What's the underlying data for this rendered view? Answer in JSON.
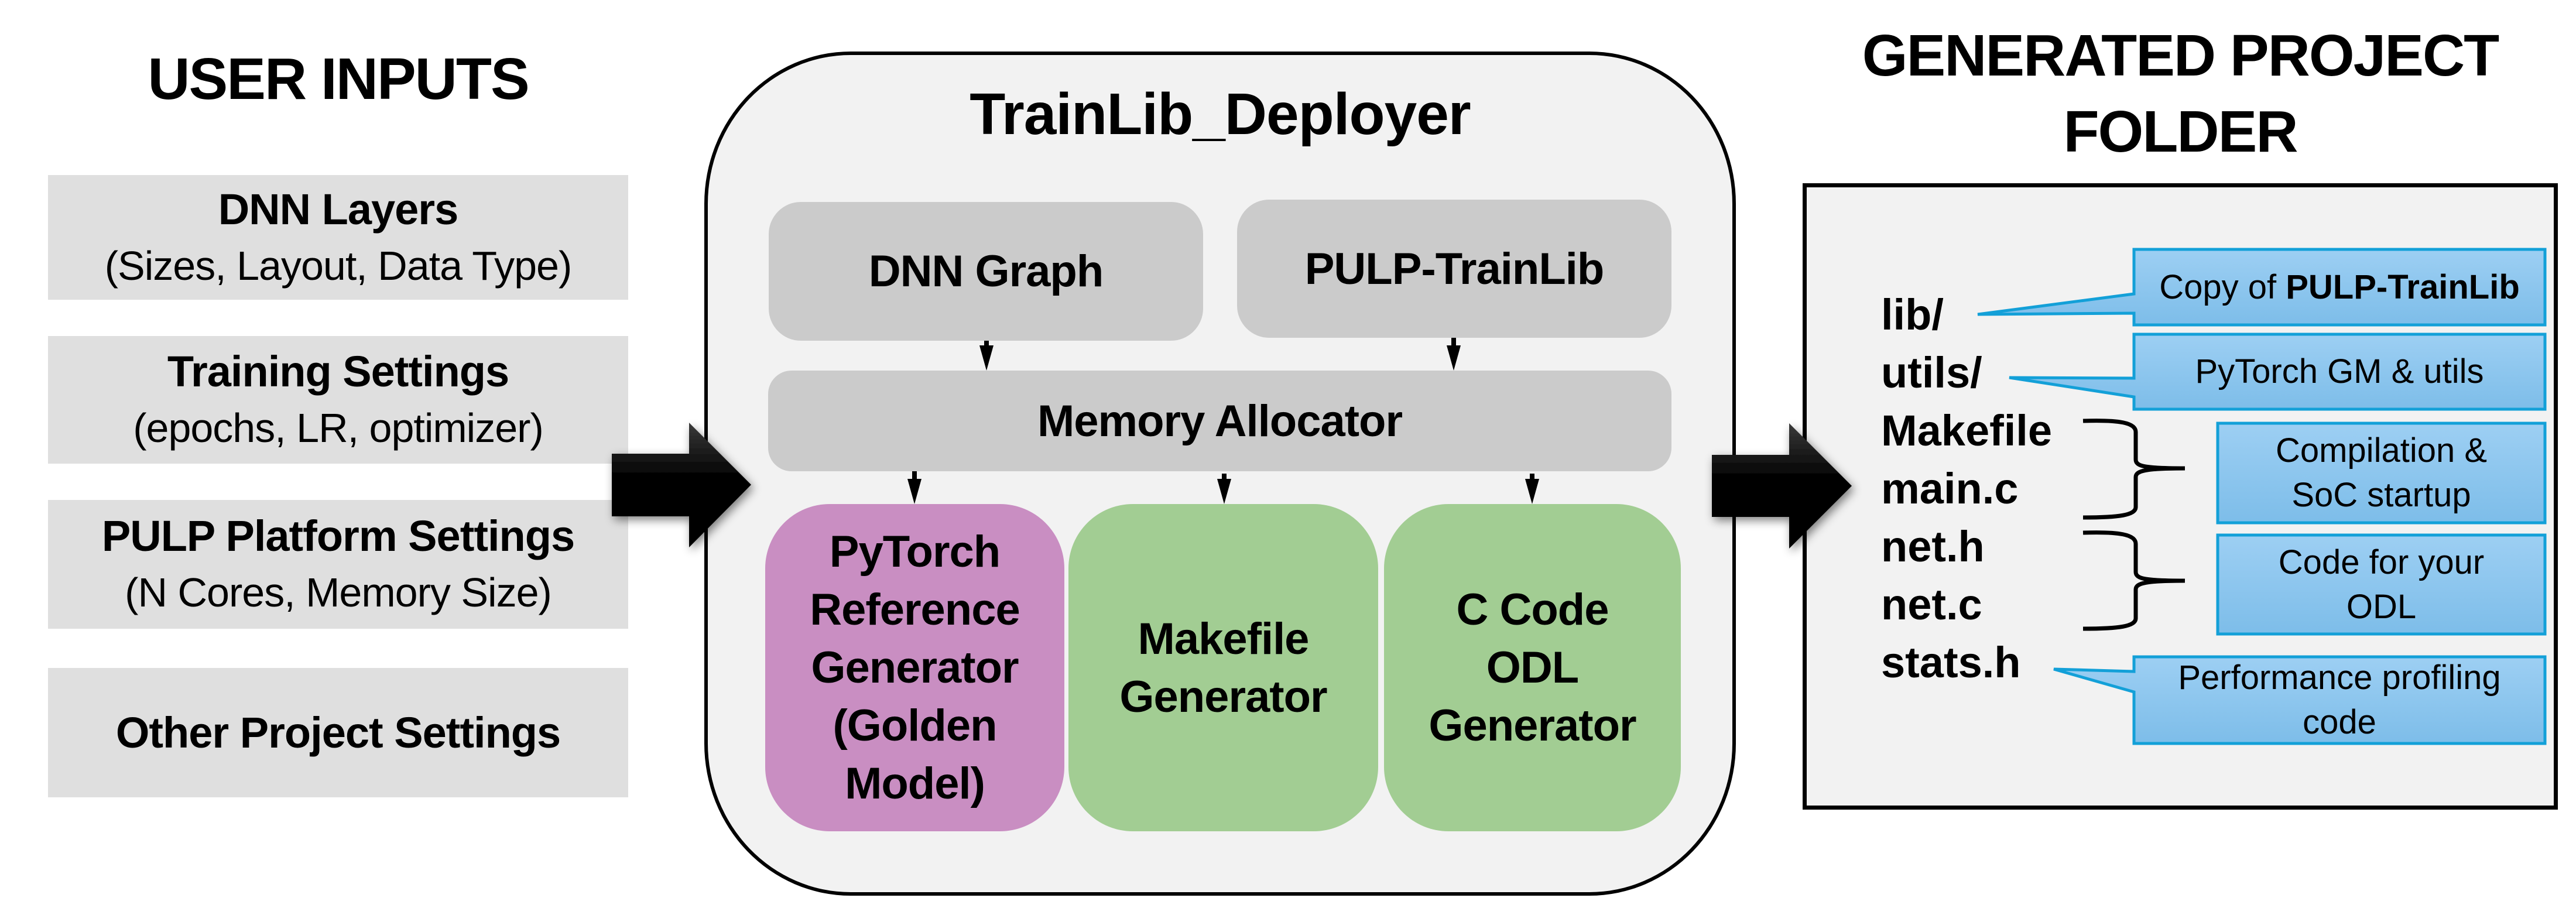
{
  "headings": {
    "user_inputs": "USER INPUTS",
    "deployer": "TrainLib_Deployer",
    "generated_folder_line1": "GENERATED PROJECT",
    "generated_folder_line2": "FOLDER"
  },
  "user_inputs": [
    {
      "title": "DNN Layers",
      "subtitle": "(Sizes, Layout, Data Type)"
    },
    {
      "title": "Training Settings",
      "subtitle": "(epochs, LR, optimizer)"
    },
    {
      "title": "PULP Platform Settings",
      "subtitle": "(N Cores, Memory Size)"
    },
    {
      "title": "Other Project Settings",
      "subtitle": ""
    }
  ],
  "deployer": {
    "sources": [
      "DNN Graph",
      "PULP-TrainLib"
    ],
    "allocator": "Memory Allocator",
    "generators": [
      {
        "lines": [
          "PyTorch",
          "Reference",
          "Generator",
          "(Golden",
          "Model)"
        ],
        "color": "#C98EC2"
      },
      {
        "lines": [
          "Makefile",
          "Generator"
        ],
        "color": "#A2CD93"
      },
      {
        "lines": [
          "C Code",
          "ODL",
          "Generator"
        ],
        "color": "#A2CD93"
      }
    ]
  },
  "folder": {
    "files": [
      "lib/",
      "utils/",
      "Makefile",
      "main.c",
      "net.h",
      "net.c",
      "stats.h"
    ],
    "callouts": [
      {
        "prefix": "Copy of ",
        "bold": "PULP-TrainLib",
        "lines": []
      },
      {
        "prefix": "",
        "bold": "",
        "lines": [
          "PyTorch GM & utils"
        ]
      },
      {
        "prefix": "",
        "bold": "",
        "lines": [
          "Compilation &",
          "SoC startup"
        ]
      },
      {
        "prefix": "",
        "bold": "",
        "lines": [
          "Code for your",
          "ODL"
        ]
      },
      {
        "prefix": "",
        "bold": "",
        "lines": [
          "Performance profiling",
          "code"
        ]
      }
    ]
  },
  "colors": {
    "input_box": "#DFDFDF",
    "deployer_bg": "#F2F2F2",
    "component_gray": "#CBCBCB",
    "golden_model": "#C98EC2",
    "generator_green": "#A2CD93",
    "callout_fill_top": "#9DCFF3",
    "callout_fill_bottom": "#7DBDE9",
    "callout_border": "#13A0D8"
  }
}
